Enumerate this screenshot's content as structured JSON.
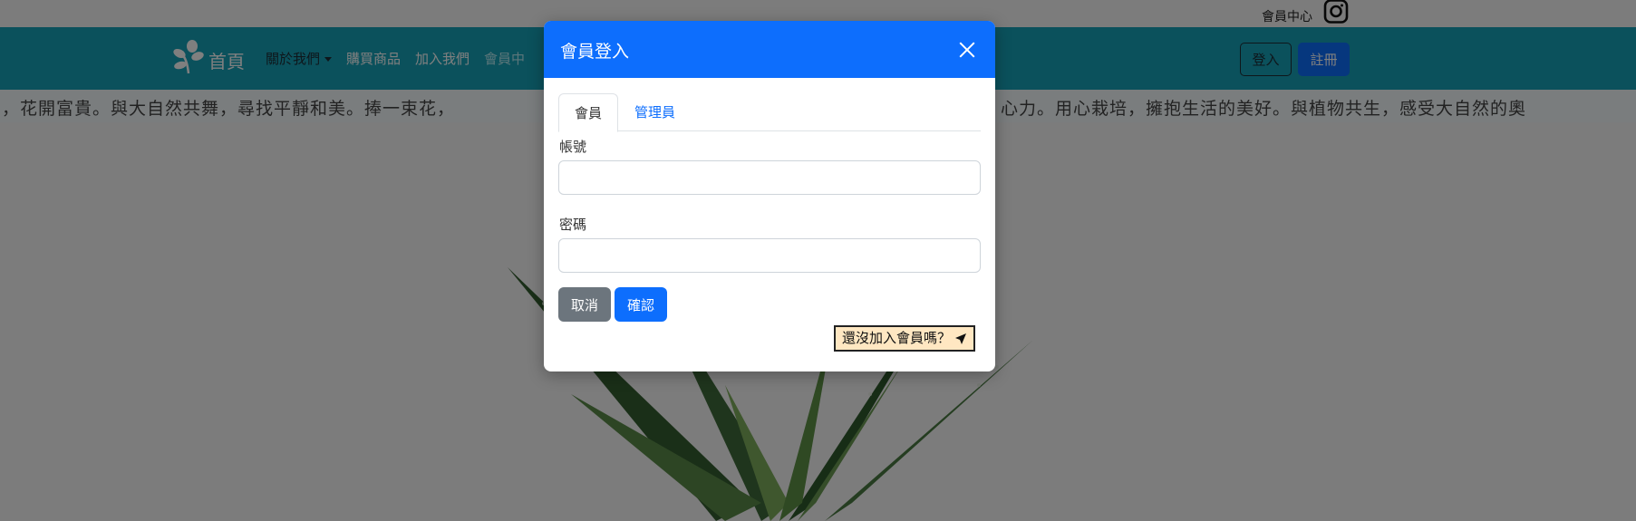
{
  "topbar": {
    "member_center": "會員中心",
    "instagram_icon": "instagram-icon"
  },
  "navbar": {
    "brand_label": "首頁",
    "brand_icon": "leaf-logo-icon",
    "links": [
      "關於我們",
      "購買商品",
      "加入我們",
      "會員中"
    ],
    "login_label": "登入",
    "register_label": "註冊"
  },
  "marquee": {
    "left_text": "，花開富貴。與大自然共舞，尋找平靜和美。捧一束花，",
    "right_text": "心力。用心栽培，擁抱生活的美好。與植物共生，感受大自然的奧"
  },
  "modal": {
    "title": "會員登入",
    "close_icon": "close-icon",
    "tabs": [
      "會員",
      "管理員"
    ],
    "account_label": "帳號",
    "account_value": "",
    "password_label": "密碼",
    "password_value": "",
    "cancel_label": "取消",
    "confirm_label": "確認",
    "join_link_label": "還沒加入會員嗎？",
    "join_link_icon": "send-arrow-icon"
  },
  "colors": {
    "navbar": "#17a2b8",
    "primary": "#0d6efd",
    "secondary": "#6c757d",
    "join_link_bg": "#ffe7c2"
  }
}
